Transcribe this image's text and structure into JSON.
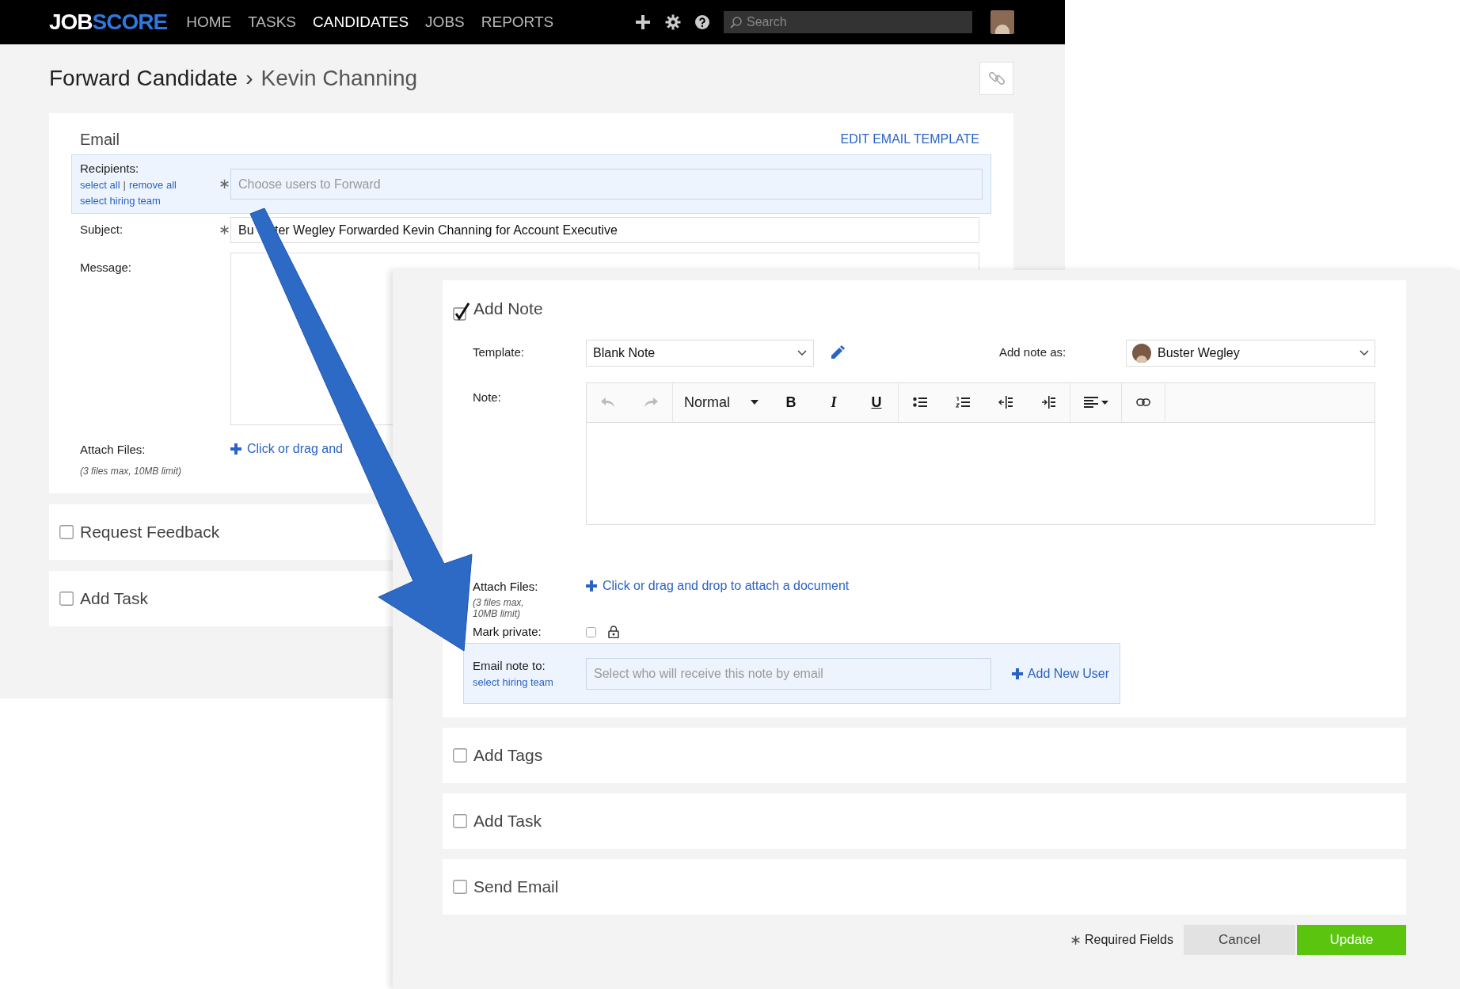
{
  "nav": {
    "logo_left": "JOB",
    "logo_right": "SCORE",
    "items": [
      {
        "label": "HOME",
        "selected": false
      },
      {
        "label": "TASKS",
        "selected": false
      },
      {
        "label": "CANDIDATES",
        "selected": true
      },
      {
        "label": "JOBS",
        "selected": false
      },
      {
        "label": "REPORTS",
        "selected": false
      }
    ],
    "search": {
      "placeholder": "Search"
    }
  },
  "page": {
    "breadcrumb": "Forward Candidate",
    "separator": "›",
    "title": "Kevin Channing"
  },
  "email": {
    "heading": "Email",
    "edit_link": "EDIT EMAIL TEMPLATE",
    "recipients": {
      "label": "Recipients:",
      "select_all": "select all",
      "divider": "|",
      "remove_all": "remove all",
      "select_team": "select hiring team",
      "required": "∗",
      "placeholder": "Choose users to Forward"
    },
    "subject": {
      "label": "Subject:",
      "required": "∗",
      "value_start": "Bu",
      "value_end": "ter Wegley Forwarded Kevin Channing for Account Executive"
    },
    "message": {
      "label": "Message:"
    },
    "attach": {
      "label": "Attach Files:",
      "limit": "(3 files max, 10MB limit)",
      "link": "Click or drag and"
    }
  },
  "background_sections": [
    {
      "label": "Request Feedback",
      "checked": false
    },
    {
      "label": "Add Task",
      "checked": false
    }
  ],
  "note": {
    "label": "Add Note",
    "checked": true,
    "template_label": "Template:",
    "template": "Blank Note",
    "as_label": "Add note as:",
    "as_user": "Buster Wegley",
    "note_label": "Note:",
    "toolbar": {
      "style": "Normal",
      "bold": "B",
      "italic": "I",
      "underline": "U"
    },
    "attach_label": "Attach Files:",
    "attach_limit": "(3 files max, 10MB limit)",
    "attach_link": "Click or drag and drop to attach a document",
    "private_label": "Mark private:",
    "private": false,
    "email_label": "Email note to:",
    "email_team": "select hiring team",
    "email_placeholder": "Select who will receive this note by email",
    "add_user": "Add New User"
  },
  "sections": [
    {
      "label": "Add Tags",
      "checked": false
    },
    {
      "label": "Add Task",
      "checked": false
    },
    {
      "label": "Send Email",
      "checked": false
    }
  ],
  "footer": {
    "required_mark": "∗",
    "required": "Required Fields",
    "cancel": "Cancel",
    "update": "Update"
  }
}
